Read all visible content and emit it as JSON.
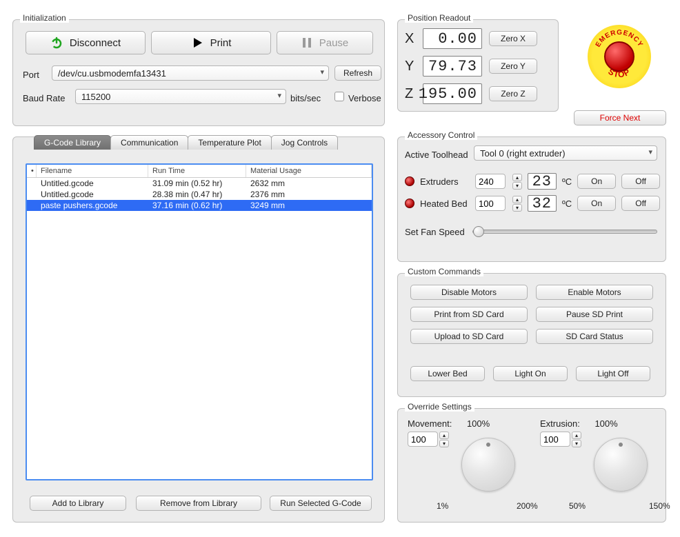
{
  "initialization": {
    "legend": "Initialization",
    "disconnect_label": "Disconnect",
    "print_label": "Print",
    "pause_label": "Pause",
    "port_label": "Port",
    "port_value": "/dev/cu.usbmodemfa13431",
    "refresh_label": "Refresh",
    "baud_label": "Baud Rate",
    "baud_value": "115200",
    "baud_unit": "bits/sec",
    "verbose_label": "Verbose"
  },
  "tabs": {
    "t1": "G-Code Library",
    "t2": "Communication",
    "t3": "Temperature Plot",
    "t4": "Jog Controls"
  },
  "library": {
    "col_mark": "•",
    "col1": "Filename",
    "col2": "Run Time",
    "col3": "Material Usage",
    "rows": [
      {
        "filename": "Untitled.gcode",
        "runtime": "31.09 min (0.52 hr)",
        "material": "2632 mm"
      },
      {
        "filename": "Untitled.gcode",
        "runtime": "28.38 min (0.47 hr)",
        "material": "2376 mm"
      },
      {
        "filename": "paste pushers.gcode",
        "runtime": "37.16 min (0.62 hr)",
        "material": "3249 mm"
      }
    ],
    "add_label": "Add to Library",
    "remove_label": "Remove from Library",
    "run_label": "Run Selected G-Code"
  },
  "position": {
    "legend": "Position Readout",
    "x_label": "X",
    "x_value": "0.00",
    "zero_x": "Zero X",
    "y_label": "Y",
    "y_value": "79.73",
    "zero_y": "Zero Y",
    "z_label": "Z",
    "z_value": "195.00",
    "zero_z": "Zero Z"
  },
  "force_next": "Force Next",
  "estop_top": "EMERGENCY",
  "estop_bottom": "STOP",
  "accessory": {
    "legend": "Accessory Control",
    "active_toolhead_label": "Active Toolhead",
    "active_toolhead_value": "Tool 0 (right extruder)",
    "extruders_label": "Extruders",
    "extruders_set": "240",
    "extruders_read": "23",
    "heatedbed_label": "Heated Bed",
    "heatedbed_set": "100",
    "heatedbed_read": "32",
    "degC": "ºC",
    "on": "On",
    "off": "Off",
    "fan_label": "Set Fan Speed"
  },
  "custom": {
    "legend": "Custom Commands",
    "disable_motors": "Disable Motors",
    "enable_motors": "Enable Motors",
    "print_sd": "Print from SD Card",
    "pause_sd": "Pause SD Print",
    "upload_sd": "Upload to SD Card",
    "sd_status": "SD Card Status",
    "lower_bed": "Lower Bed",
    "light_on": "Light On",
    "light_off": "Light Off"
  },
  "override": {
    "legend": "Override Settings",
    "movement_label": "Movement:",
    "movement_pct": "100%",
    "movement_val": "100",
    "movement_min": "1%",
    "movement_max": "200%",
    "extrusion_label": "Extrusion:",
    "extrusion_pct": "100%",
    "extrusion_val": "100",
    "extrusion_min": "50%",
    "extrusion_max": "150%"
  }
}
